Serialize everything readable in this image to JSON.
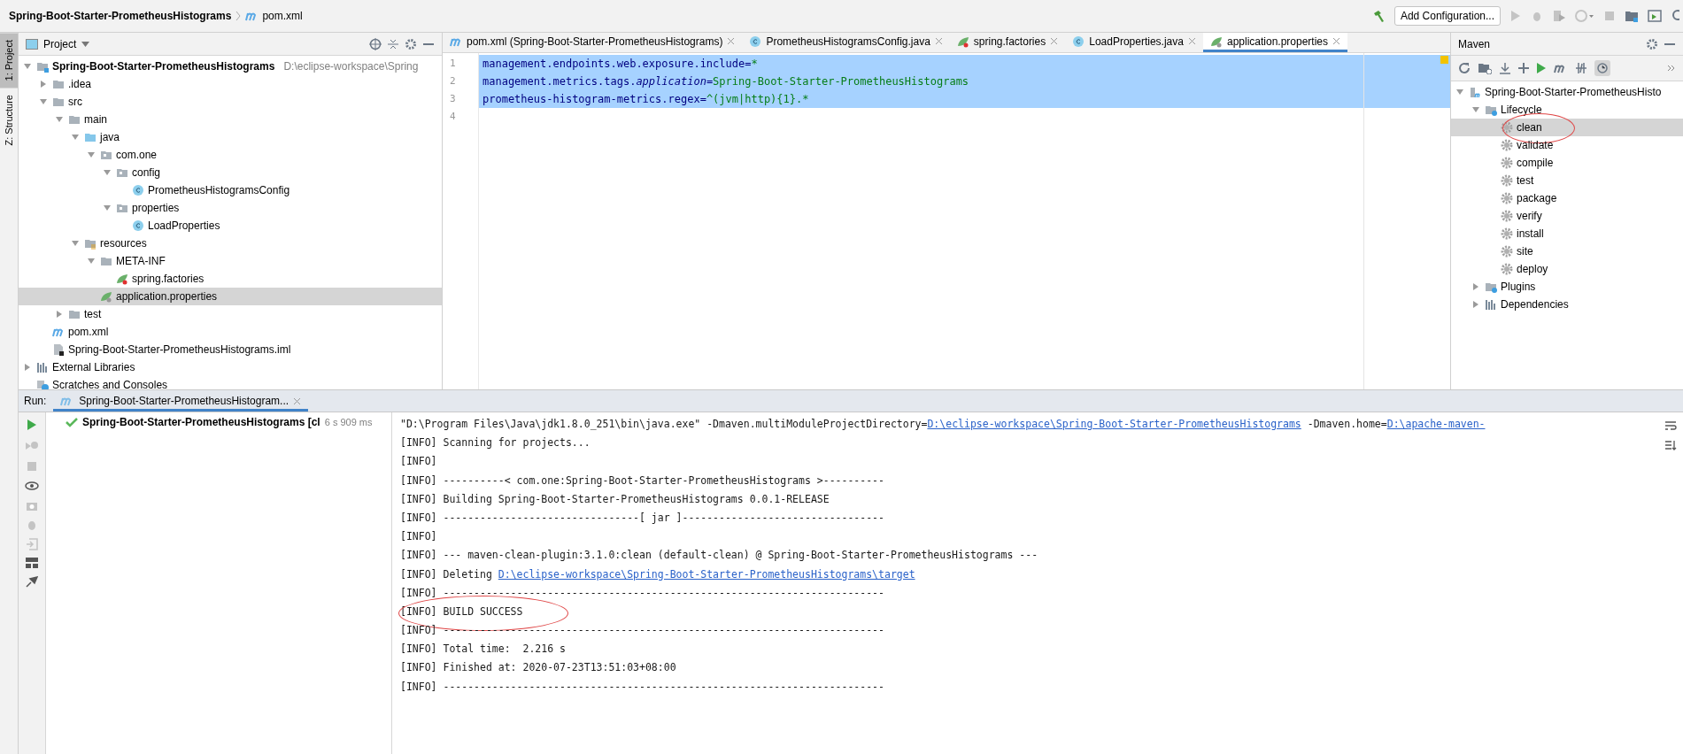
{
  "title_bar": {
    "project": "Spring-Boot-Starter-PrometheusHistograms",
    "file": "pom.xml"
  },
  "toolbar": {
    "config_button": "Add Configuration..."
  },
  "side_tabs": [
    {
      "label": "1: Project",
      "selected": true
    },
    {
      "label": "Z: Structure",
      "selected": false
    }
  ],
  "project_panel": {
    "title": "Project",
    "tree": [
      {
        "label": "Spring-Boot-Starter-PrometheusHistograms",
        "kind": "project",
        "detail": "D:\\eclipse-workspace\\Spring",
        "expanded": true,
        "selected": false,
        "children": [
          {
            "label": ".idea",
            "kind": "folder",
            "expanded": false,
            "selected": false
          },
          {
            "label": "src",
            "kind": "folder",
            "expanded": true,
            "selected": false,
            "children": [
              {
                "label": "main",
                "kind": "folder",
                "expanded": true,
                "selected": false,
                "children": [
                  {
                    "label": "java",
                    "kind": "source",
                    "expanded": true,
                    "selected": false,
                    "children": [
                      {
                        "label": "com.one",
                        "kind": "package",
                        "expanded": true,
                        "selected": false,
                        "children": [
                          {
                            "label": "config",
                            "kind": "package",
                            "expanded": true,
                            "selected": false,
                            "children": [
                              {
                                "label": "PrometheusHistogramsConfig",
                                "kind": "class",
                                "selected": false
                              }
                            ]
                          },
                          {
                            "label": "properties",
                            "kind": "package",
                            "expanded": true,
                            "selected": false,
                            "children": [
                              {
                                "label": "LoadProperties",
                                "kind": "class",
                                "selected": false
                              }
                            ]
                          }
                        ]
                      }
                    ]
                  },
                  {
                    "label": "resources",
                    "kind": "resources",
                    "expanded": true,
                    "selected": false,
                    "children": [
                      {
                        "label": "META-INF",
                        "kind": "folder",
                        "expanded": true,
                        "selected": false,
                        "children": [
                          {
                            "label": "spring.factories",
                            "kind": "spring",
                            "selected": false
                          }
                        ]
                      },
                      {
                        "label": "application.properties",
                        "kind": "springprops",
                        "selected": true
                      }
                    ]
                  }
                ]
              },
              {
                "label": "test",
                "kind": "folder",
                "expanded": false,
                "selected": false
              }
            ]
          },
          {
            "label": "pom.xml",
            "kind": "maven",
            "selected": false
          },
          {
            "label": "Spring-Boot-Starter-PrometheusHistograms.iml",
            "kind": "iml",
            "selected": false
          }
        ]
      },
      {
        "label": "External Libraries",
        "kind": "libraries",
        "expanded": false,
        "selected": false
      },
      {
        "label": "Scratches and Consoles",
        "kind": "scratches",
        "selected": false
      }
    ]
  },
  "editor": {
    "tabs": [
      {
        "label": "pom.xml (Spring-Boot-Starter-PrometheusHistograms)",
        "kind": "maven",
        "selected": false
      },
      {
        "label": "PrometheusHistogramsConfig.java",
        "kind": "class",
        "selected": false
      },
      {
        "label": "spring.factories",
        "kind": "spring",
        "selected": false
      },
      {
        "label": "LoadProperties.java",
        "kind": "class",
        "selected": false
      },
      {
        "label": "application.properties",
        "kind": "springprops",
        "selected": true
      }
    ],
    "lines": [
      {
        "number": "1",
        "key": "management.endpoints.web.exposure.include=",
        "value": "*",
        "selected": true
      },
      {
        "number": "2",
        "key": "management.metrics.tags.*application*=",
        "value": "Spring-Boot-Starter-PrometheusHistograms",
        "selected": true
      },
      {
        "number": "3",
        "key": "prometheus-histogram-metrics.regex=",
        "value": "^(jvm|http){1}.*",
        "selected": true
      },
      {
        "number": "4",
        "selected": false
      }
    ]
  },
  "maven": {
    "title": "Maven",
    "tree": [
      {
        "label": "Spring-Boot-Starter-PrometheusHisto",
        "kind": "mavenproject",
        "expanded": true,
        "selected": false,
        "children": [
          {
            "label": "Lifecycle",
            "kind": "lifecycle",
            "expanded": true,
            "selected": false,
            "children": [
              {
                "label": "clean",
                "kind": "goal",
                "selected": true,
                "circled": true
              },
              {
                "label": "validate",
                "kind": "goal",
                "selected": false
              },
              {
                "label": "compile",
                "kind": "goal",
                "selected": false
              },
              {
                "label": "test",
                "kind": "goal",
                "selected": false
              },
              {
                "label": "package",
                "kind": "goal",
                "selected": false
              },
              {
                "label": "verify",
                "kind": "goal",
                "selected": false
              },
              {
                "label": "install",
                "kind": "goal",
                "selected": false
              },
              {
                "label": "site",
                "kind": "goal",
                "selected": false
              },
              {
                "label": "deploy",
                "kind": "goal",
                "selected": false
              }
            ]
          },
          {
            "label": "Plugins",
            "kind": "lifecycle",
            "expanded": false,
            "selected": false
          },
          {
            "label": "Dependencies",
            "kind": "libraries",
            "expanded": false,
            "selected": false
          }
        ]
      }
    ]
  },
  "run": {
    "label": "Run:",
    "tab": "Spring-Boot-Starter-PrometheusHistogram...",
    "item": {
      "label": "Spring-Boot-Starter-PrometheusHistograms [cl",
      "time": "6 s 909 ms"
    },
    "console": [
      {
        "parts": [
          {
            "text": "\"D:\\Program Files\\Java\\jdk1.8.0_251\\bin\\java.exe\" -Dmaven.multiModuleProjectDirectory=",
            "link": false
          },
          {
            "text": "D:\\eclipse-workspace\\Spring-Boot-Starter-PrometheusHistograms",
            "link": true
          },
          {
            "text": " -Dmaven.home=",
            "link": false
          },
          {
            "text": "D:\\apache-maven-",
            "link": true
          }
        ]
      },
      {
        "parts": [
          {
            "text": "[INFO] Scanning for projects...",
            "link": false
          }
        ]
      },
      {
        "parts": [
          {
            "text": "[INFO]",
            "link": false
          }
        ]
      },
      {
        "parts": [
          {
            "text": "[INFO] ----------< com.one:Spring-Boot-Starter-PrometheusHistograms >----------",
            "link": false
          }
        ]
      },
      {
        "parts": [
          {
            "text": "[INFO] Building Spring-Boot-Starter-PrometheusHistograms 0.0.1-RELEASE",
            "link": false
          }
        ]
      },
      {
        "parts": [
          {
            "text": "[INFO] --------------------------------[ jar ]---------------------------------",
            "link": false
          }
        ]
      },
      {
        "parts": [
          {
            "text": "[INFO]",
            "link": false
          }
        ]
      },
      {
        "parts": [
          {
            "text": "[INFO] --- maven-clean-plugin:3.1.0:clean (default-clean) @ Spring-Boot-Starter-PrometheusHistograms ---",
            "link": false
          }
        ]
      },
      {
        "parts": [
          {
            "text": "[INFO] Deleting ",
            "link": false
          },
          {
            "text": "D:\\eclipse-workspace\\Spring-Boot-Starter-PrometheusHistograms\\target",
            "link": true
          }
        ]
      },
      {
        "parts": [
          {
            "text": "[INFO] ------------------------------------------------------------------------",
            "link": false
          }
        ]
      },
      {
        "parts": [
          {
            "text": "[INFO] BUILD SUCCESS",
            "link": false
          }
        ],
        "circled": true
      },
      {
        "parts": [
          {
            "text": "[INFO] ------------------------------------------------------------------------",
            "link": false
          }
        ]
      },
      {
        "parts": [
          {
            "text": "[INFO] Total time:  2.216 s",
            "link": false
          }
        ]
      },
      {
        "parts": [
          {
            "text": "[INFO] Finished at: 2020-07-23T13:51:03+08:00",
            "link": false
          }
        ]
      },
      {
        "parts": [
          {
            "text": "[INFO] ------------------------------------------------------------------------",
            "link": false
          }
        ]
      }
    ]
  }
}
